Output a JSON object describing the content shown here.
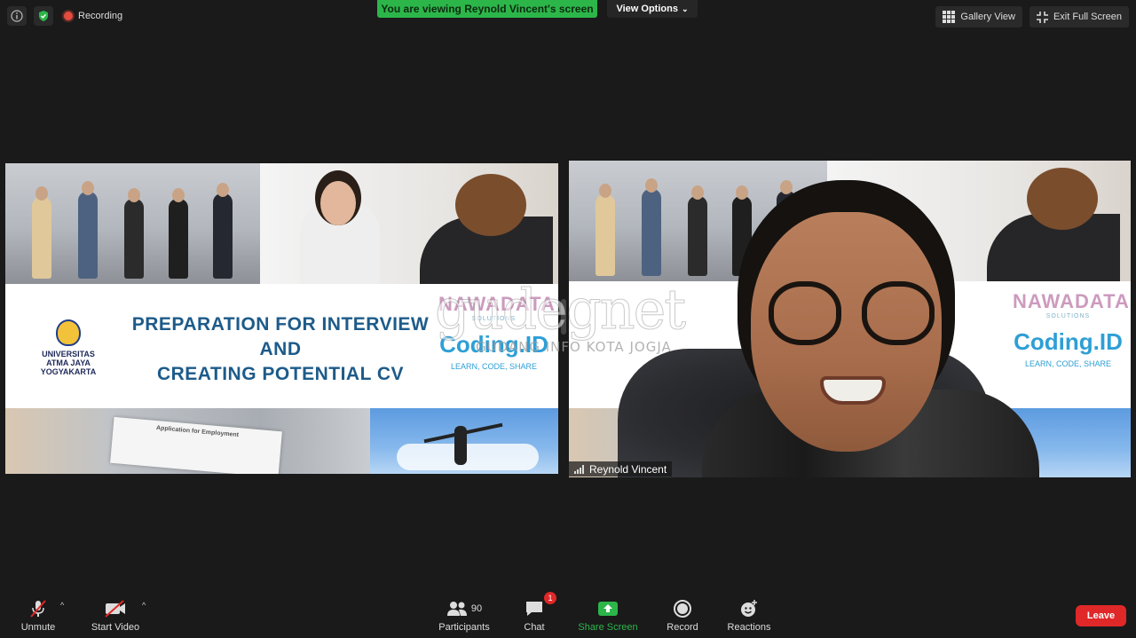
{
  "top": {
    "recording_label": "Recording",
    "viewing_banner": "You are viewing Reynold Vincent's screen",
    "view_options_label": "View Options",
    "gallery_view_label": "Gallery View",
    "exit_full_screen_label": "Exit Full Screen"
  },
  "shared_slide": {
    "university_line1": "UNIVERSITAS",
    "university_line2": "ATMA JAYA YOGYAKARTA",
    "title_line1": "PREPARATION FOR INTERVIEW",
    "title_line2": "AND",
    "title_line3": "CREATING POTENTIAL CV",
    "brand_name": "NAWADATA",
    "brand_sub": "SOLUTIONS",
    "coding_logo": "Coding.ID",
    "coding_tagline": "LEARN, CODE, SHARE",
    "paper_text": "Application for Employment"
  },
  "speaker": {
    "name": "Reynold Vincent"
  },
  "watermark": {
    "main": "gudegnet",
    "sub": "GUDANG INFO KOTA JOGJA"
  },
  "toolbar": {
    "unmute_label": "Unmute",
    "start_video_label": "Start Video",
    "participants_label": "Participants",
    "participants_count": "90",
    "chat_label": "Chat",
    "chat_badge": "1",
    "share_screen_label": "Share Screen",
    "record_label": "Record",
    "reactions_label": "Reactions",
    "leave_label": "Leave"
  },
  "colors": {
    "banner_green": "#2cb64a",
    "share_green": "#2cb64a",
    "leave_red": "#e02828",
    "title_blue": "#1d5b8a",
    "coding_blue": "#2e9fd6"
  }
}
